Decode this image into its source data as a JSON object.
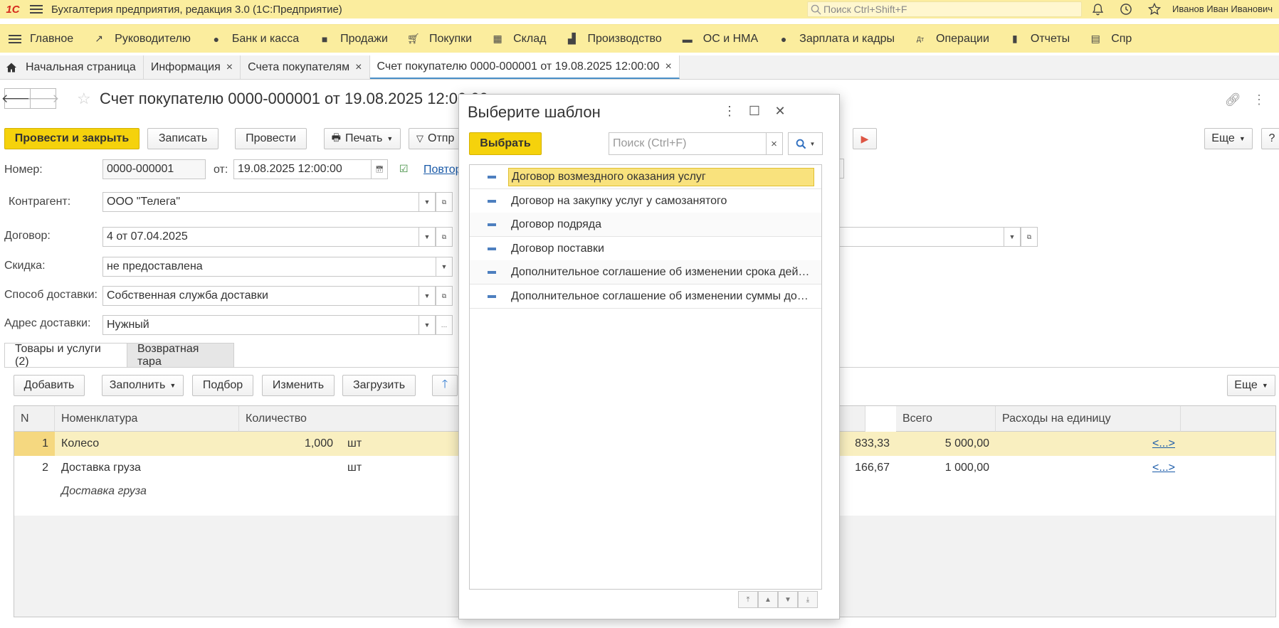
{
  "titlebar": {
    "logo": "1С",
    "app_title": "Бухгалтерия предприятия, редакция 3.0  (1С:Предприятие)",
    "search_placeholder": "Поиск Ctrl+Shift+F",
    "user": "Иванов Иван Иванович"
  },
  "sections": [
    {
      "label": "Главное",
      "icon": "menu-icon"
    },
    {
      "label": "Руководителю",
      "icon": "trend-icon"
    },
    {
      "label": "Банк и касса",
      "icon": "coin-icon"
    },
    {
      "label": "Продажи",
      "icon": "bag-icon"
    },
    {
      "label": "Покупки",
      "icon": "cart-icon"
    },
    {
      "label": "Склад",
      "icon": "grid-icon"
    },
    {
      "label": "Производство",
      "icon": "factory-icon"
    },
    {
      "label": "ОС и НМА",
      "icon": "truck-icon"
    },
    {
      "label": "Зарплата и кадры",
      "icon": "person-icon"
    },
    {
      "label": "Операции",
      "icon": "dtkt-icon"
    },
    {
      "label": "Отчеты",
      "icon": "bars-icon"
    },
    {
      "label": "Спр",
      "icon": "book-icon"
    }
  ],
  "tabs": [
    {
      "label": "Начальная страница"
    },
    {
      "label": "Информация"
    },
    {
      "label": "Счета покупателям"
    },
    {
      "label": "Счет покупателю 0000-000001 от 19.08.2025 12:00:00"
    }
  ],
  "document": {
    "title": "Счет покупателю 0000-000001 от 19.08.2025 12:00:00",
    "buttons": {
      "post_close": "Провести и закрыть",
      "save": "Записать",
      "post": "Провести",
      "print": "Печать",
      "send": "Отпр",
      "more": "Еще",
      "help": "?"
    },
    "fields": {
      "number_label": "Номер:",
      "number_value": "0000-000001",
      "date_label": "от:",
      "date_value": "19.08.2025 12:00:00",
      "repeat_link": "Повтор",
      "contractor_label": "Контрагент:",
      "contractor_value": "ООО \"Телега\"",
      "contract_label": "Договор:",
      "contract_value": "4 от 07.04.2025",
      "discount_label": "Скидка:",
      "discount_value": "не предоставлена",
      "delivery_label": "Способ доставки:",
      "delivery_value": "Собственная служба доставки",
      "address_label": "Адрес доставки:",
      "address_value": "Нужный"
    },
    "inner_tabs": [
      "Товары и услуги (2)",
      "Возвратная тара"
    ],
    "table_buttons": {
      "add": "Добавить",
      "fill": "Заполнить",
      "pick": "Подбор",
      "change": "Изменить",
      "load": "Загрузить",
      "more": "Еще"
    },
    "table": {
      "columns": [
        "N",
        "Номенклатура",
        "Количество",
        "Всего",
        "Расходы на единицу"
      ],
      "rows": [
        {
          "n": "1",
          "name": "Колесо",
          "qty": "1,000",
          "unit": "шт",
          "price_tail": "833,33",
          "total": "5 000,00",
          "expense": "<...>"
        },
        {
          "n": "2",
          "name": "Доставка груза",
          "qty": "",
          "unit": "шт",
          "price_tail": "166,67",
          "total": "1 000,00",
          "expense": "<...>",
          "subtitle": "Доставка груза"
        }
      ]
    }
  },
  "modal": {
    "title": "Выберите шаблон",
    "select_button": "Выбрать",
    "search_placeholder": "Поиск (Ctrl+F)",
    "items": [
      "Договор возмездного оказания услуг",
      "Договор на закупку услуг у самозанятого",
      "Договор подряда",
      "Договор поставки",
      "Дополнительное соглашение об изменении срока действия договора",
      "Дополнительное соглашение об изменении суммы договора"
    ]
  },
  "colors": {
    "accent_yellow": "#f5d20c",
    "bar_yellow": "#fbed9e",
    "link_blue": "#1a5aa8",
    "selected_row": "#f9efc0"
  }
}
